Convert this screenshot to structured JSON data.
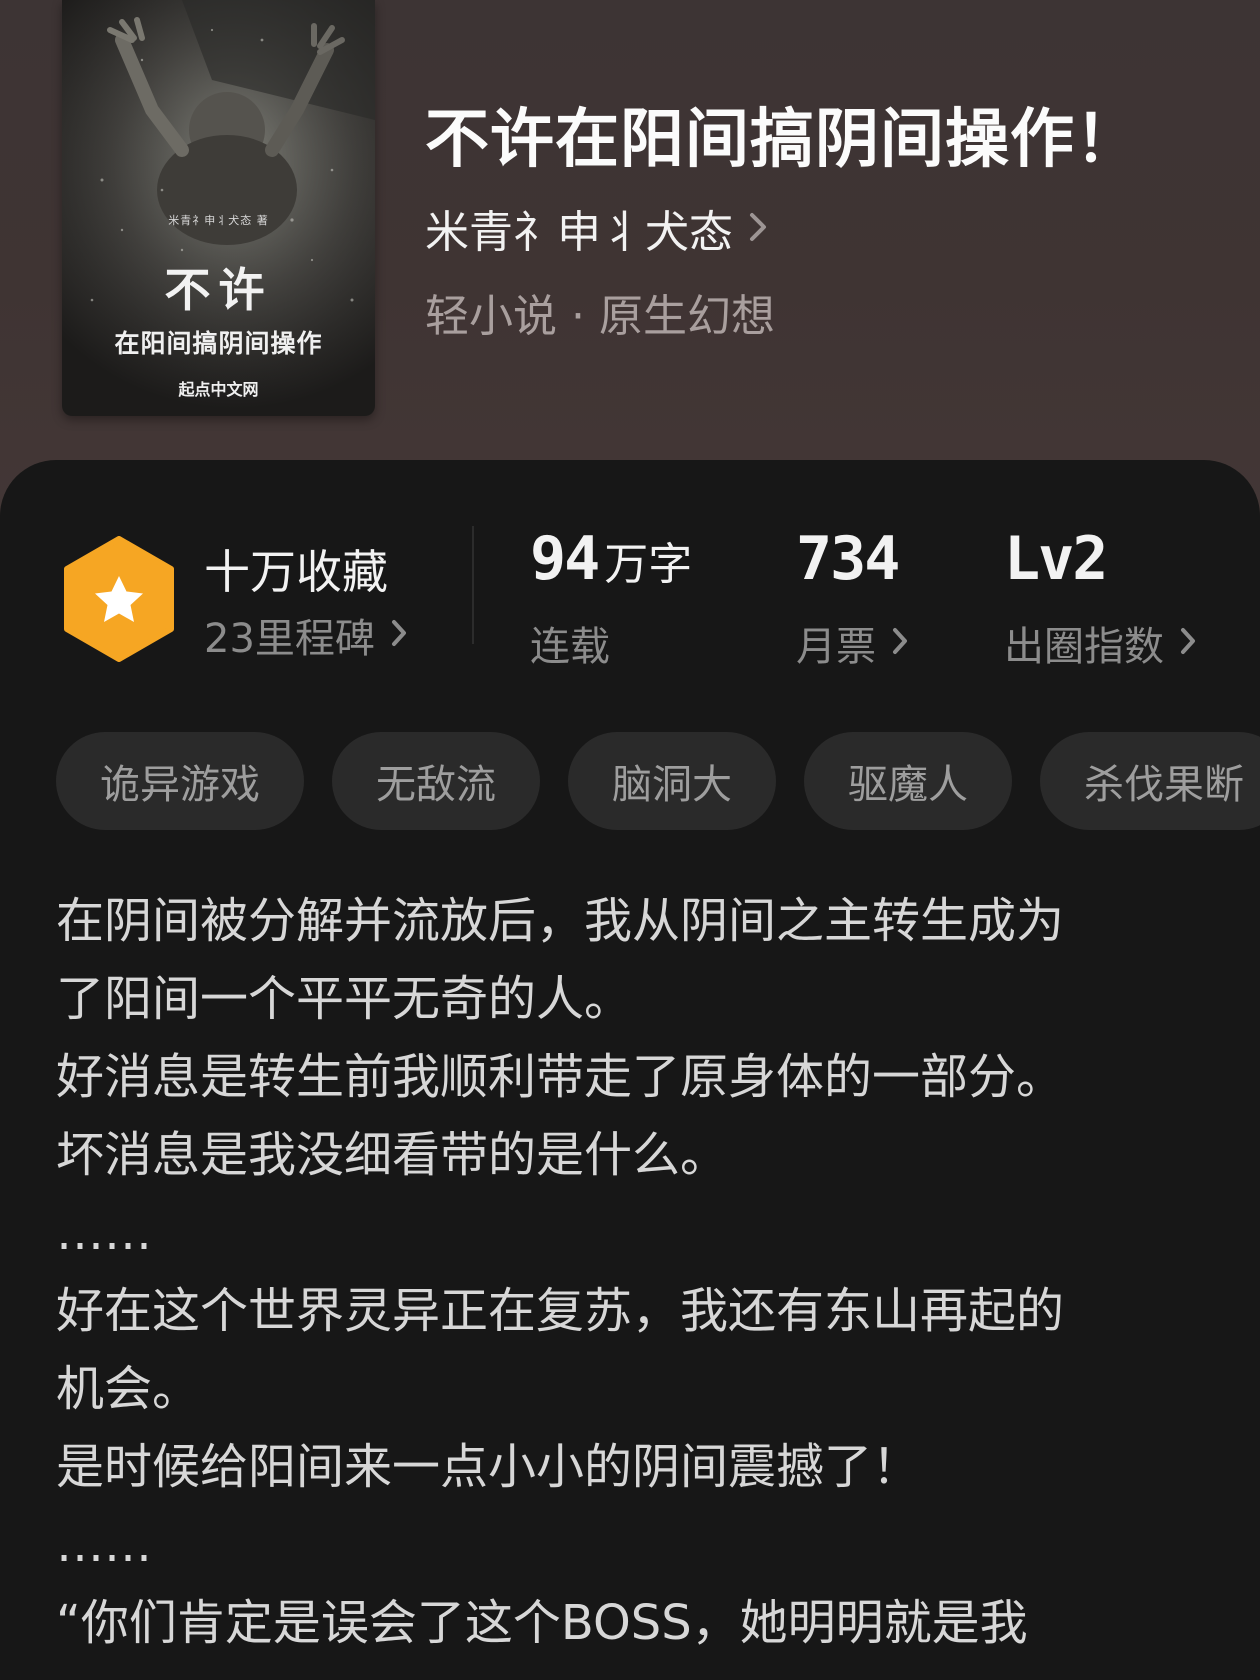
{
  "book": {
    "title": "不许在阳间搞阴间操作！",
    "author": "米青礻申丬犬态",
    "genre": "轻小说 · 原生幻想",
    "cover": {
      "author_line": "米青礻申丬犬态 著",
      "big_title": "不许",
      "sub_title": "在阳间搞阴间操作",
      "publisher": "起点中文网"
    }
  },
  "stats": {
    "collection": {
      "title": "十万收藏",
      "subtitle": "23里程碑"
    },
    "words": {
      "number": "94",
      "unit": "万字",
      "label": "连载"
    },
    "tickets": {
      "number": "734",
      "label": "月票"
    },
    "index": {
      "number": "Lv2",
      "label": "出圈指数"
    }
  },
  "tags": [
    "诡异游戏",
    "无敌流",
    "脑洞大",
    "驱魔人",
    "杀伐果断"
  ],
  "synopsis": [
    "在阴间被分解并流放后，我从阴间之主转生成为",
    "了阳间一个平平无奇的人。",
    "好消息是转生前我顺利带走了原身体的一部分。",
    "坏消息是我没细看带的是什么。",
    "……",
    "好在这个世界灵异正在复苏，我还有东山再起的",
    "机会。",
    "是时候给阳间来一点小小的阴间震撼了！",
    "……",
    "“你们肯定是误会了这个BOSS，她明明就是我"
  ],
  "colors": {
    "header_bg": "#3f3534",
    "panel_bg": "#171717",
    "badge_orange": "#f5a623",
    "tag_bg": "#2a2a2a"
  }
}
